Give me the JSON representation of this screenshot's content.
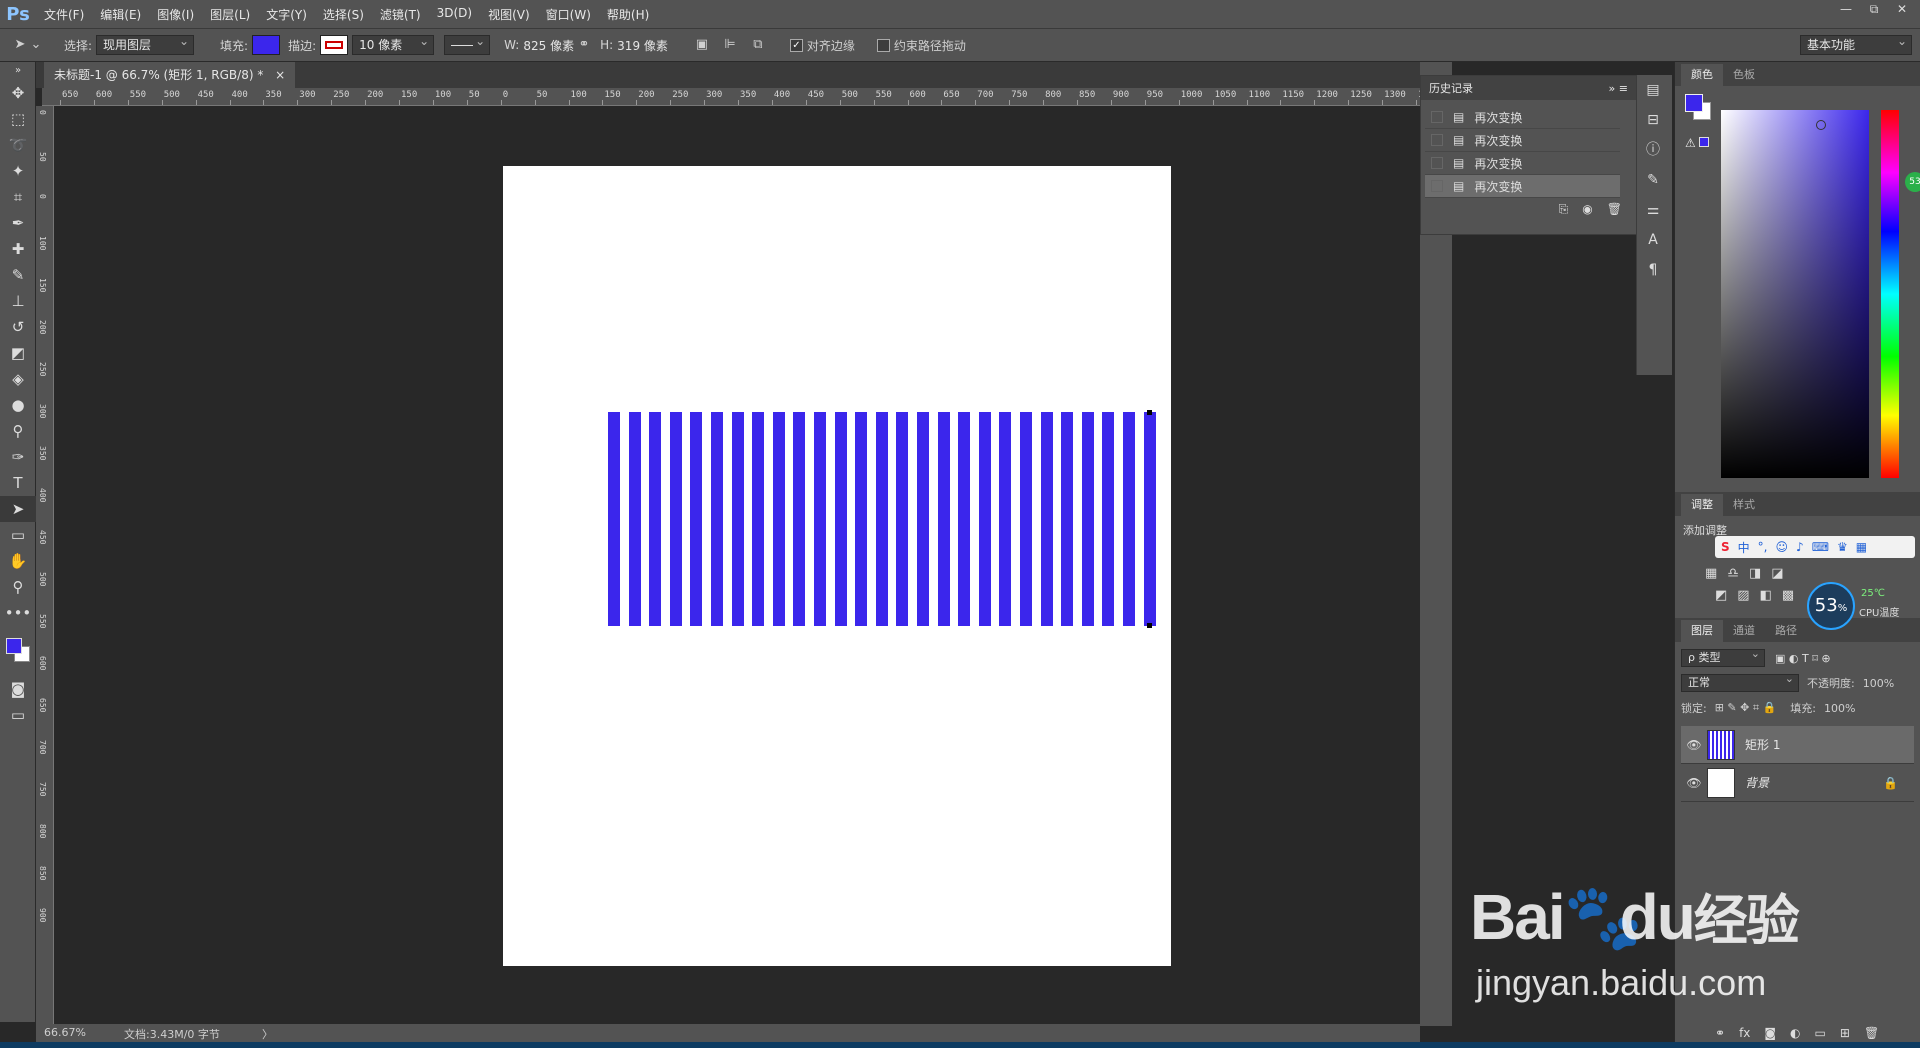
{
  "app": {
    "logo": "Ps"
  },
  "menu": [
    "文件(F)",
    "编辑(E)",
    "图像(I)",
    "图层(L)",
    "文字(Y)",
    "选择(S)",
    "滤镜(T)",
    "3D(D)",
    "视图(V)",
    "窗口(W)",
    "帮助(H)"
  ],
  "window_controls": [
    "—",
    "⧉",
    "✕"
  ],
  "options": {
    "select_label": "选择:",
    "select_value": "现用图层",
    "fill_label": "填充:",
    "fill_color": "#3b26ec",
    "stroke_label": "描边:",
    "stroke_size": "10 像素",
    "w_label": "W:",
    "w_value": "825 像素",
    "h_label": "H:",
    "h_value": "319 像素",
    "align_edges": "对齐边缘",
    "align_edges_checked": true,
    "constrain": "约束路径拖动",
    "constrain_checked": false,
    "workspace": "基本功能"
  },
  "document": {
    "tab_title": "未标题-1 @ 66.7% (矩形 1, RGB/8) *",
    "close": "×",
    "shape_color": "#3b26ec",
    "stripe_count": 27
  },
  "ruler_top": [
    "650",
    "600",
    "550",
    "500",
    "450",
    "400",
    "350",
    "300",
    "250",
    "200",
    "150",
    "100",
    "50",
    "0",
    "50",
    "100",
    "150",
    "200",
    "250",
    "300",
    "350",
    "400",
    "450",
    "500",
    "550",
    "600",
    "650",
    "700",
    "750",
    "800",
    "850",
    "900",
    "950",
    "1000",
    "1050",
    "1100",
    "1150",
    "1200",
    "1250",
    "1300",
    "135"
  ],
  "ruler_left": [
    "0",
    "50",
    "0",
    "100",
    "150",
    "200",
    "250",
    "300",
    "350",
    "400",
    "450",
    "500",
    "550",
    "600",
    "650",
    "700",
    "750",
    "800",
    "850",
    "900"
  ],
  "status": {
    "zoom": "66.67%",
    "doc": "文档:3.43M/0 字节",
    "arrow": "〉"
  },
  "history": {
    "title": "历史记录",
    "items": [
      "再次变换",
      "再次变换",
      "再次变换",
      "再次变换"
    ],
    "selected_index": 3
  },
  "color_panel": {
    "tabs": [
      "颜色",
      "色板"
    ],
    "fg": "#3b26ec",
    "bg": "#ffffff"
  },
  "adjust_panel": {
    "tabs": [
      "调整",
      "样式"
    ],
    "add_label": "添加调整"
  },
  "layers_panel": {
    "tabs": [
      "图层",
      "通道",
      "路径"
    ],
    "filter_label": "ρ 类型",
    "blend_mode": "正常",
    "opacity_label": "不透明度:",
    "opacity": "100%",
    "lock_label": "锁定:",
    "fill_label": "填充:",
    "fill": "100%",
    "layers": [
      {
        "name": "矩形 1",
        "selected": true,
        "locked": false
      },
      {
        "name": "背景",
        "selected": false,
        "locked": true
      }
    ]
  },
  "widget": {
    "percent": "53",
    "percent_sign": "%",
    "temp": "25℃",
    "cpu": "CPU温度",
    "badge": "53",
    "ime": "中"
  },
  "watermark": {
    "brand": "Bai",
    "brand2": "du",
    "cn": "经验",
    "url": "jingyan.baidu.com"
  }
}
